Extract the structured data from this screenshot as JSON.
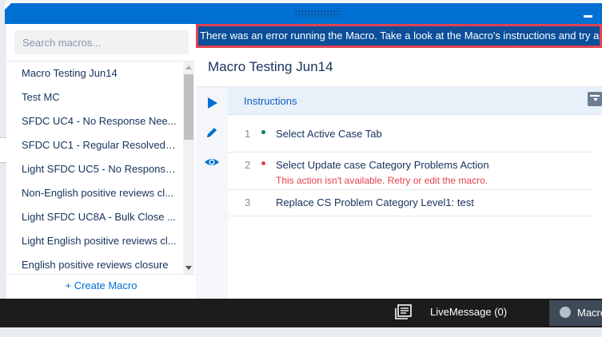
{
  "search": {
    "placeholder": "Search macros..."
  },
  "macros": [
    "Macro Testing Jun14",
    "Test MC",
    "SFDC UC4 - No Response Nee...",
    "SFDC UC1 - Regular Resolved C...",
    "Light SFDC UC5 - No Response...",
    "Non-English positive reviews cl...",
    "Light SFDC UC8A - Bulk Close ...",
    "Light English positive reviews cl...",
    "English positive reviews closure"
  ],
  "create_macro_label": "+ Create Macro",
  "error_banner": "There was an error running the Macro. Take a look at the Macro's instructions and try ag",
  "macro_title": "Macro Testing Jun14",
  "instructions_label": "Instructions",
  "steps": [
    {
      "number": "1",
      "status": "success",
      "text": "Select Active Case Tab",
      "error": ""
    },
    {
      "number": "2",
      "status": "error",
      "text": "Select Update case Category Problems Action",
      "error": "This action isn't available. Retry or edit the macro."
    },
    {
      "number": "3",
      "status": "none",
      "text": "Replace CS Problem Category Level1: test",
      "error": ""
    }
  ],
  "utility_bar": {
    "live_message_label": "LiveMessage (0)",
    "macros_label": "Macros"
  },
  "colors": {
    "brand_blue": "#0070d2",
    "error_red": "#e0424f",
    "success_green": "#04844b"
  },
  "icons": [
    "minimize-icon",
    "play-icon",
    "edit-pencil-icon",
    "preview-eye-icon",
    "archive-icon",
    "live-message-icon",
    "macros-bolt-icon"
  ]
}
